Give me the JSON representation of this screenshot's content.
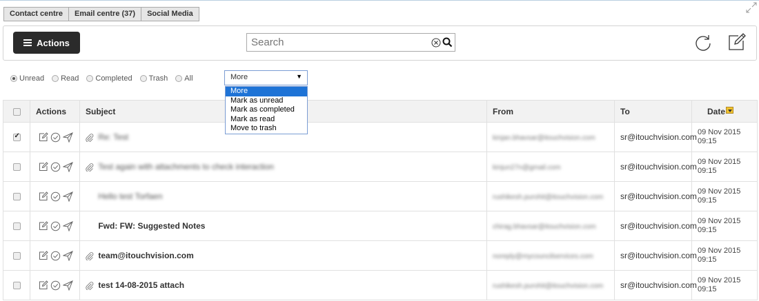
{
  "tabs": [
    {
      "label": "Contact centre"
    },
    {
      "label": "Email centre (37)"
    },
    {
      "label": "Social Media"
    }
  ],
  "toolbar": {
    "actions_label": "Actions",
    "search_placeholder": "Search"
  },
  "filters": [
    {
      "label": "Unread",
      "selected": true
    },
    {
      "label": "Read",
      "selected": false
    },
    {
      "label": "Completed",
      "selected": false
    },
    {
      "label": "Trash",
      "selected": false
    },
    {
      "label": "All",
      "selected": false
    }
  ],
  "more_dropdown": {
    "selected": "More",
    "options": [
      "More",
      "Mark as unread",
      "Mark as completed",
      "Mark as read",
      "Move to trash"
    ]
  },
  "table": {
    "headers": {
      "actions": "Actions",
      "subject": "Subject",
      "from": "From",
      "to": "To",
      "date": "Date"
    },
    "rows": [
      {
        "checked": true,
        "attachment": true,
        "subject": "Re: Test",
        "subject_blurred": true,
        "from": "kinjan.bhavsar@itouchvision.com",
        "to": "sr@itouchvision.com",
        "date": "09 Nov 2015",
        "time": "09:15"
      },
      {
        "checked": false,
        "attachment": true,
        "subject": "Test again with attachments to check interaction",
        "subject_blurred": true,
        "from": "kinjun27n@gmail.com",
        "to": "sr@itouchvision.com",
        "date": "09 Nov 2015",
        "time": "09:15"
      },
      {
        "checked": false,
        "attachment": false,
        "subject": "Hello test Torfaen",
        "subject_blurred": true,
        "from": "rushikesh.purohit@itouchvision.com",
        "to": "sr@itouchvision.com",
        "date": "09 Nov 2015",
        "time": "09:15"
      },
      {
        "checked": false,
        "attachment": false,
        "subject": "Fwd: FW: Suggested Notes",
        "subject_blurred": false,
        "from": "chirag.bhavsar@itouchvision.com",
        "to": "sr@itouchvision.com",
        "date": "09 Nov 2015",
        "time": "09:15"
      },
      {
        "checked": false,
        "attachment": true,
        "subject": "team@itouchvision.com",
        "subject_blurred": false,
        "from": "noreply@mycouncilservices.com",
        "to": "sr@itouchvision.com",
        "date": "09 Nov 2015",
        "time": "09:15"
      },
      {
        "checked": false,
        "attachment": true,
        "subject": "test 14-08-2015 attach",
        "subject_blurred": false,
        "from": "rushikesh.purohit@itouchvision.com",
        "to": "sr@itouchvision.com",
        "date": "09 Nov 2015",
        "time": "09:15"
      }
    ]
  },
  "icons": {
    "expand": "expand-icon",
    "refresh": "refresh-icon",
    "compose": "compose-icon",
    "row_actions": [
      "edit-icon",
      "complete-check-icon",
      "send-icon"
    ],
    "attachment": "paperclip-icon",
    "sort": "sort-desc-icon"
  },
  "colors": {
    "actions_button": "#2b2b2b",
    "dropdown_highlight": "#1e73d6",
    "sort_icon": "#f0c22e",
    "header_bg": "#f2f2f2"
  }
}
